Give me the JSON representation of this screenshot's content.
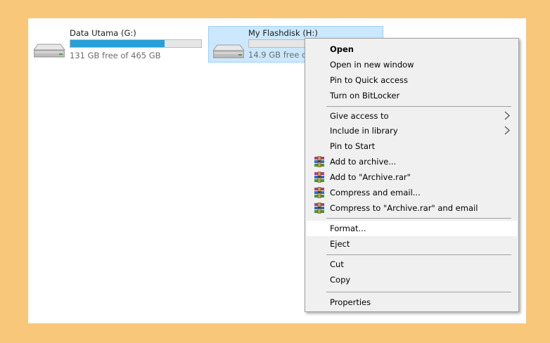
{
  "drives": [
    {
      "name": "Data Utama (G:)",
      "free_text": "131 GB free of 465 GB",
      "used_fraction": 0.72,
      "selected": false
    },
    {
      "name": "My Flashdisk (H:)",
      "free_text": "14.9 GB free of",
      "used_fraction": 0.0,
      "selected": true
    }
  ],
  "context_menu": {
    "items": [
      {
        "label": "Open",
        "bold": true
      },
      {
        "label": "Open in new window"
      },
      {
        "label": "Pin to Quick access"
      },
      {
        "label": "Turn on BitLocker"
      },
      {
        "label": "Give access to",
        "submenu": true
      },
      {
        "label": "Include in library",
        "submenu": true
      },
      {
        "label": "Pin to Start"
      },
      {
        "label": "Add to archive...",
        "icon": "winrar-icon"
      },
      {
        "label": "Add to \"Archive.rar\"",
        "icon": "winrar-icon"
      },
      {
        "label": "Compress and email...",
        "icon": "winrar-icon"
      },
      {
        "label": "Compress to \"Archive.rar\" and email",
        "icon": "winrar-icon"
      },
      {
        "label": "Format...",
        "hovered": true
      },
      {
        "label": "Eject"
      },
      {
        "label": "Cut"
      },
      {
        "label": "Copy"
      },
      {
        "label": "Properties"
      }
    ]
  },
  "colors": {
    "page_background": "#f8c77a",
    "selection_fill": "#cce8ff",
    "selection_border": "#99d1ff",
    "bar_fill": "#26a0da",
    "menu_background": "#f0f0f0"
  }
}
